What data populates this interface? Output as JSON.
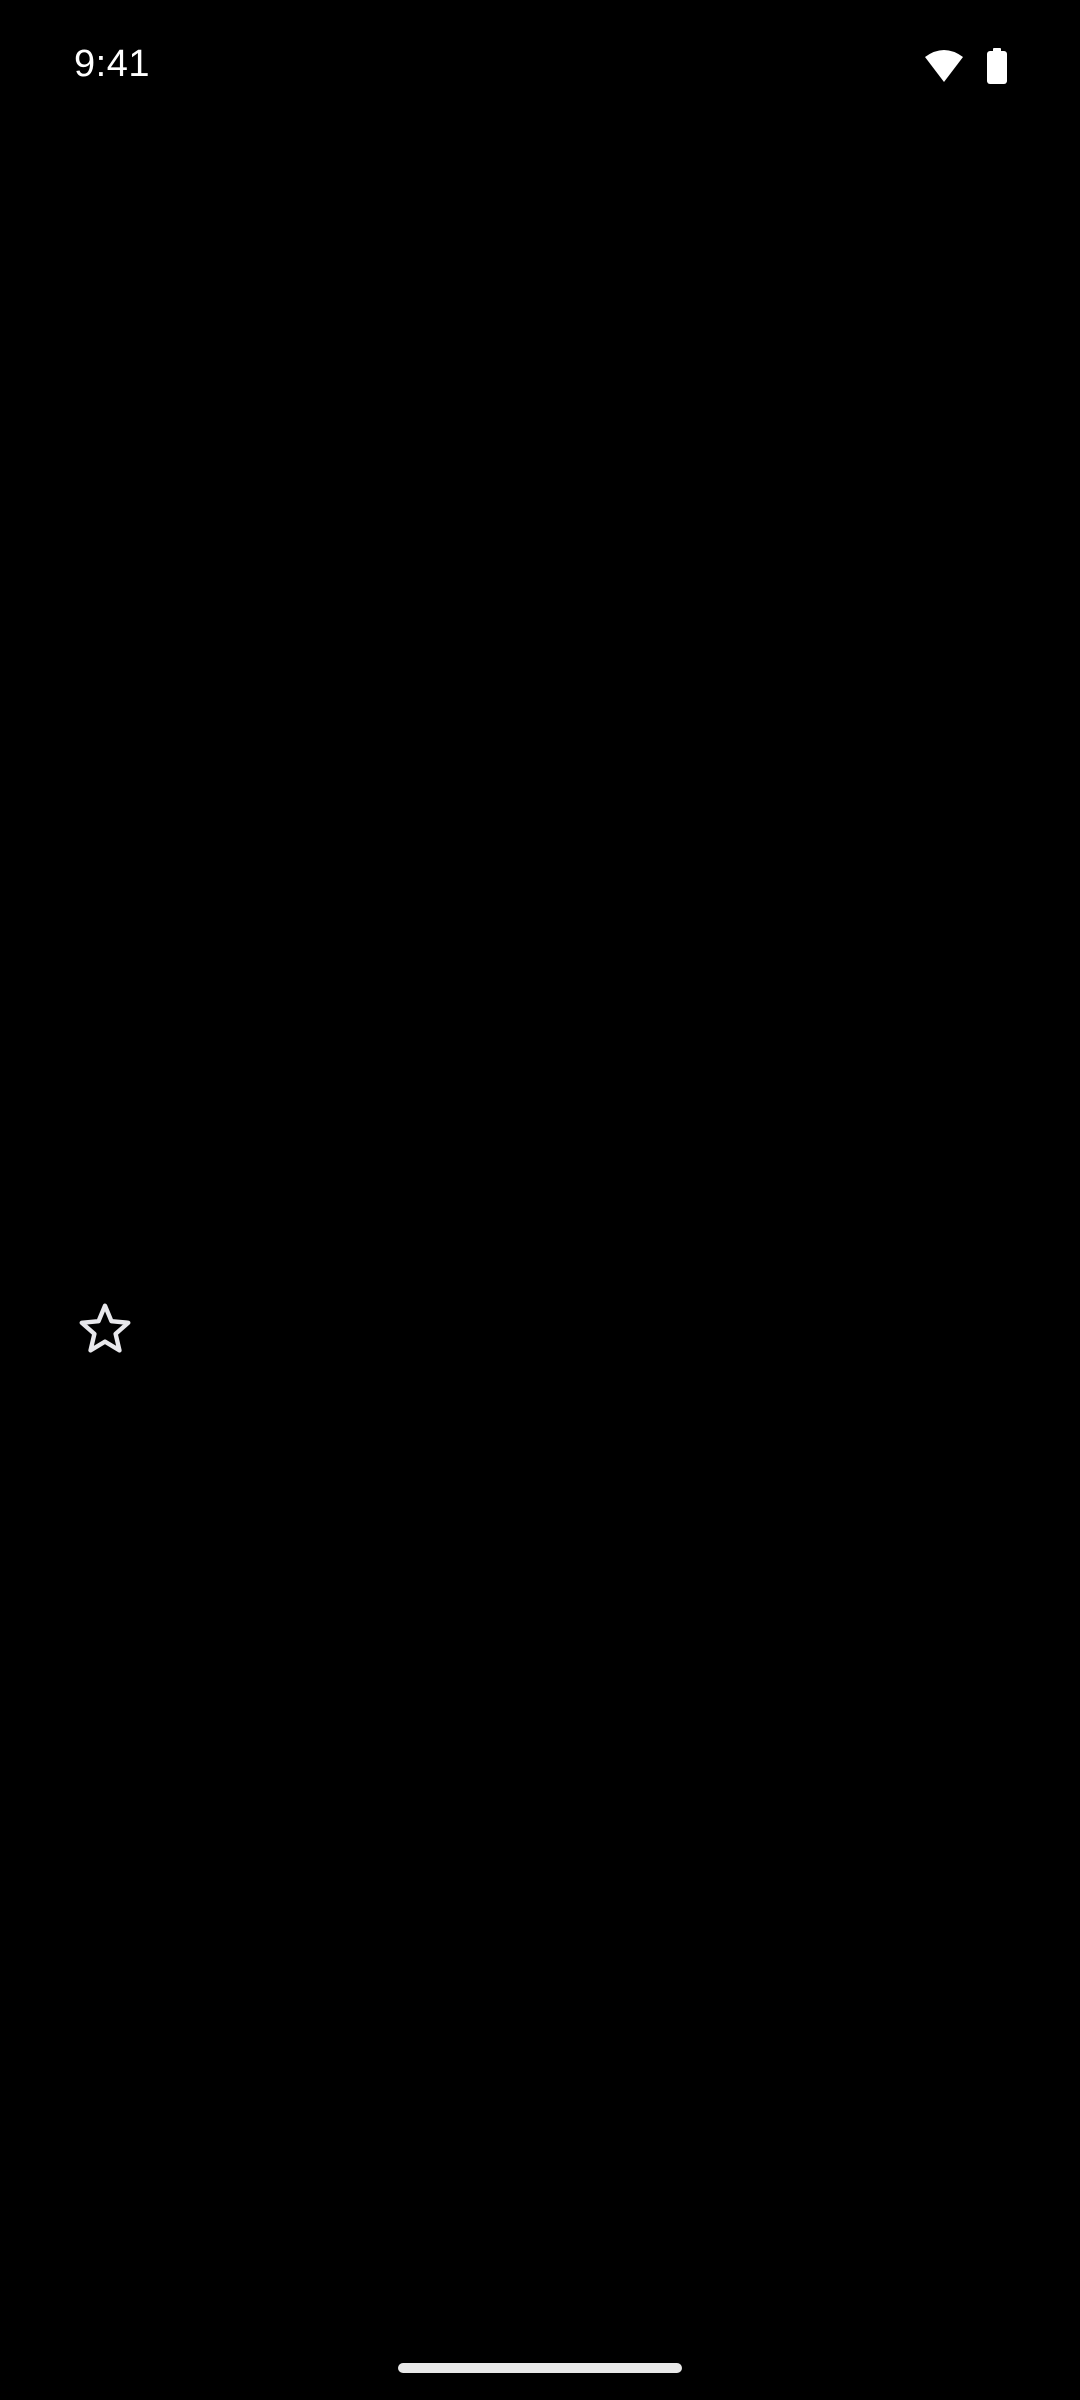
{
  "status_bar": {
    "time": "9:41",
    "wifi_icon": "wifi-icon",
    "battery_icon": "battery-icon"
  },
  "main": {
    "favorite_icon": "star-outline-icon"
  },
  "navigation": {
    "gesture_bar": "gesture-handle"
  },
  "colors": {
    "background": "#000000",
    "foreground": "#ffffff",
    "icon_outline": "#e8e8ec"
  }
}
